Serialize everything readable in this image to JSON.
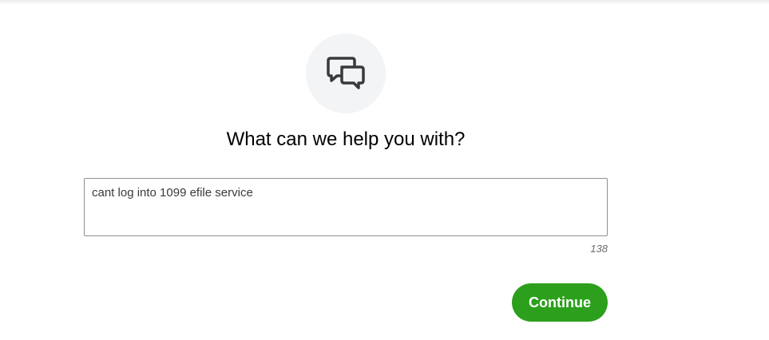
{
  "header": {
    "icon": "chat-bubbles-icon"
  },
  "main": {
    "heading": "What can we help you with?",
    "question_input": {
      "value": "cant log into 1099 efile service"
    },
    "char_count": "138",
    "continue_label": "Continue"
  },
  "colors": {
    "accent": "#2ca01c",
    "icon_circle_bg": "#f3f4f6",
    "icon": "#393a3d"
  }
}
